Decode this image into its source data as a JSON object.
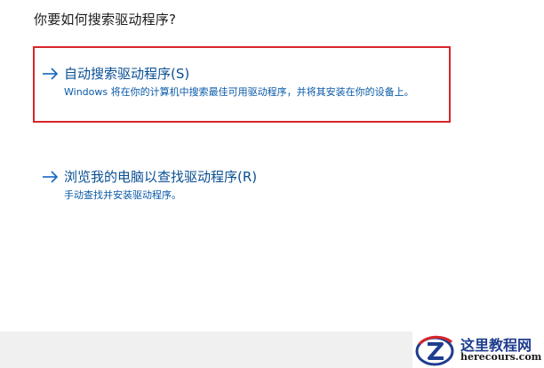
{
  "dialog": {
    "question": "你要如何搜索驱动程序?",
    "options": [
      {
        "title": "自动搜索驱动程序(S)",
        "description": "Windows 将在你的计算机中搜索最佳可用驱动程序，并将其安装在你的设备上。"
      },
      {
        "title": "浏览我的电脑以查找驱动程序(R)",
        "description": "手动查找并安装驱动程序。"
      }
    ]
  },
  "watermark": {
    "name": "这里教程网",
    "url": "herecours.com"
  },
  "colors": {
    "link": "#0a4f93",
    "highlight": "#d9252b",
    "footer": "#f0f0f0"
  },
  "icons": {
    "option_arrow": "arrow-right-icon",
    "watermark_logo": "z-globe-logo-icon"
  }
}
